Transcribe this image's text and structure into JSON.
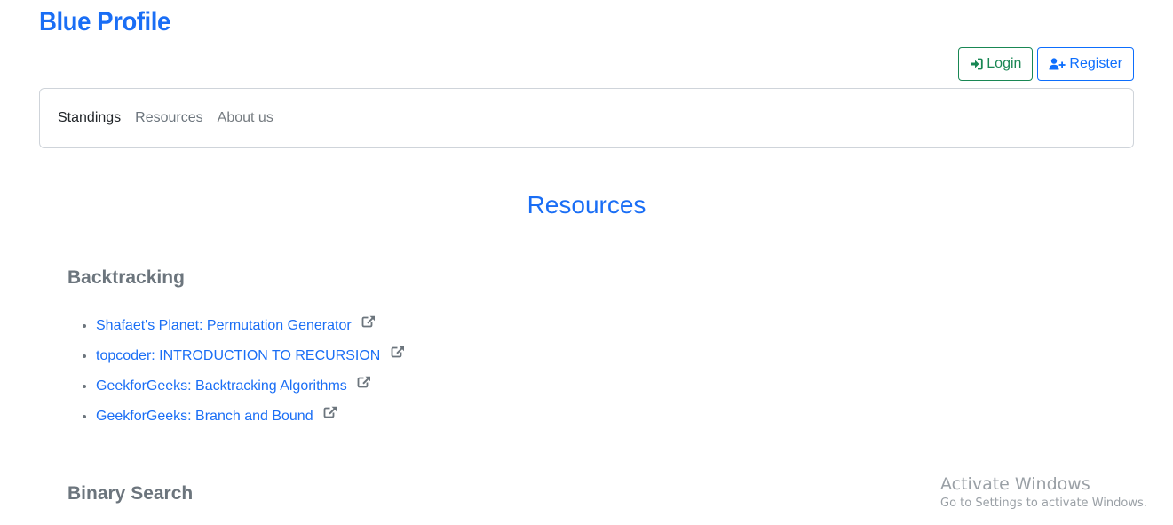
{
  "header": {
    "brand": "Blue Profile",
    "login_label": "Login",
    "register_label": "Register",
    "login_icon": "sign-in-icon",
    "register_icon": "user-plus-icon"
  },
  "nav": {
    "items": [
      {
        "label": "Standings"
      },
      {
        "label": "Resources"
      },
      {
        "label": "About us"
      }
    ]
  },
  "main": {
    "title": "Resources",
    "sections": [
      {
        "heading": "Backtracking",
        "links": [
          {
            "label": "Shafaet's Planet: Permutation Generator"
          },
          {
            "label": "topcoder: INTRODUCTION TO RECURSION"
          },
          {
            "label": "GeekforGeeks: Backtracking Algorithms"
          },
          {
            "label": "GeekforGeeks: Branch and Bound"
          }
        ]
      },
      {
        "heading": "Binary Search",
        "links": []
      }
    ],
    "link_icon": "external-link-icon"
  },
  "watermark": {
    "title": "Activate Windows",
    "subtitle": "Go to Settings to activate Windows."
  },
  "colors": {
    "brand": "#1a6ef5",
    "login": "#198754",
    "register": "#0d6efd",
    "heading_muted": "#6c757d"
  }
}
